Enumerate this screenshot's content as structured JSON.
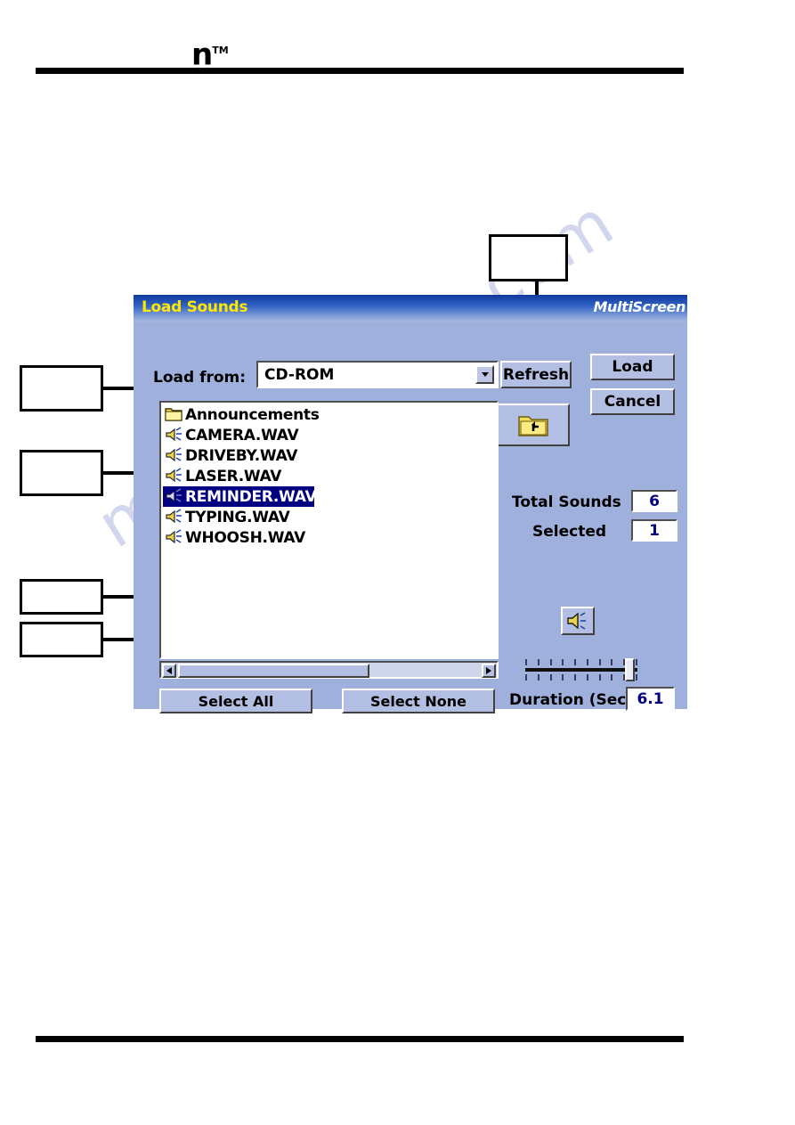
{
  "page": {
    "logo_letter": "n",
    "logo_tm": "TM",
    "watermark": "manualshive.com"
  },
  "dialog": {
    "title": "Load Sounds",
    "brand": "MultiScreen",
    "load_from_label": "Load from:",
    "source": {
      "value": "CD-ROM",
      "options": [
        "CD-ROM"
      ]
    },
    "refresh_label": "Refresh",
    "load_label": "Load",
    "cancel_label": "Cancel",
    "up_folder_icon": "folder-up-icon",
    "play_icon": "speaker-icon",
    "list": {
      "items": [
        {
          "name": "Announcements",
          "icon": "folder-icon",
          "type": "folder",
          "selected": false
        },
        {
          "name": "CAMERA.WAV",
          "icon": "wave-file-icon",
          "type": "file",
          "selected": false
        },
        {
          "name": "DRIVEBY.WAV",
          "icon": "wave-file-icon",
          "type": "file",
          "selected": false
        },
        {
          "name": "LASER.WAV",
          "icon": "wave-file-icon",
          "type": "file",
          "selected": false
        },
        {
          "name": "REMINDER.WAV",
          "icon": "wave-file-icon",
          "type": "file",
          "selected": true
        },
        {
          "name": "TYPING.WAV",
          "icon": "wave-file-icon",
          "type": "file",
          "selected": false
        },
        {
          "name": "WHOOSH.WAV",
          "icon": "wave-file-icon",
          "type": "file",
          "selected": false
        }
      ]
    },
    "counters": {
      "total_label": "Total Sounds",
      "total_value": "6",
      "selected_label": "Selected",
      "selected_value": "1"
    },
    "select_all_label": "Select All",
    "select_none_label": "Select None",
    "duration_label": "Duration (Sec)",
    "duration_value": "6.1",
    "slider": {
      "tick_count": 10,
      "position_percent": 92
    },
    "colors": {
      "dialog_background": "#9fb0dc",
      "title_text": "#ffe800",
      "selection": "#000080",
      "field_text": "#000080"
    }
  },
  "callouts": [
    {
      "id": "callout-top",
      "target": "up-folder-button"
    },
    {
      "id": "callout-folder",
      "target": "folder-list-item"
    },
    {
      "id": "callout-selected",
      "target": "selected-list-item"
    },
    {
      "id": "callout-play",
      "target": "play-button"
    },
    {
      "id": "callout-slider",
      "target": "duration-slider"
    }
  ]
}
